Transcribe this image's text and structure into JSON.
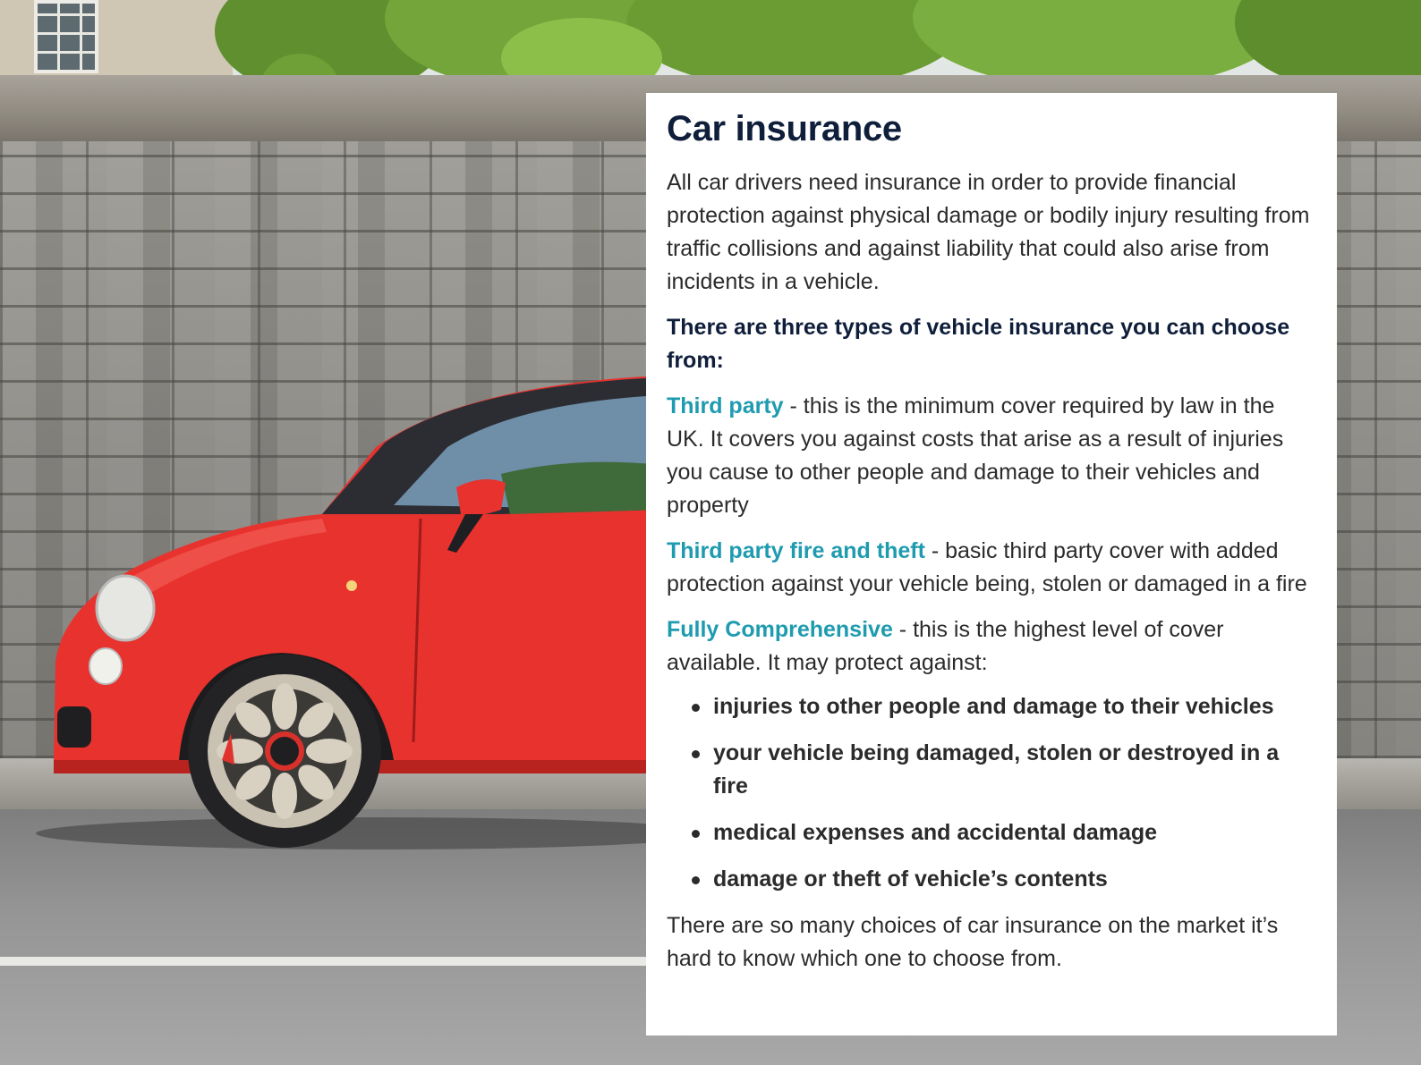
{
  "card": {
    "title": "Car insurance",
    "intro": "All car drivers need insurance in order to provide financial protection against physical damage or bodily injury resulting from traffic collisions and against liability that could also arise from incidents in a vehicle.",
    "subheading": "There are three types of vehicle insurance you can choose from:",
    "types": [
      {
        "term": "Third party",
        "description": " - this is the minimum cover required by law in the UK. It covers you against costs that arise as a result of injuries you cause to other people and damage to their vehicles and property"
      },
      {
        "term": "Third party fire and theft",
        "description": " - basic third party cover with added protection against your vehicle being, stolen or damaged in a fire"
      },
      {
        "term": "Fully Comprehensive",
        "description": " - this is the highest level of cover available. It may protect against:"
      }
    ],
    "bullets": [
      "injuries to other people and damage to their vehicles",
      "your vehicle being damaged, stolen or destroyed in a fire",
      "medical expenses and accidental damage",
      "damage or theft of vehicle’s contents"
    ],
    "closing": "There are so many choices of car insurance on the market it’s hard to know which one to choose from."
  },
  "colors": {
    "title": "#0f1e3a",
    "term_accent": "#1f9bb0",
    "body_text": "#2b2b2b",
    "car_red": "#e8322e"
  }
}
